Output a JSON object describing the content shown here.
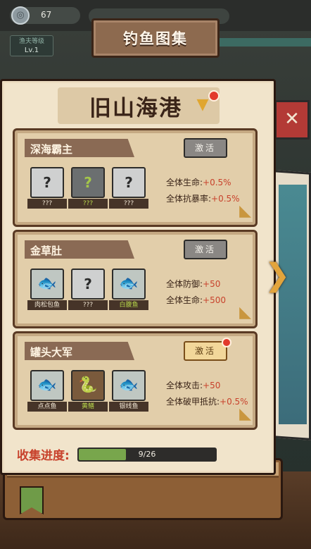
{
  "topbar": {
    "coin_value": "67",
    "level_title": "渔夫等级",
    "level_value": "Lv.1"
  },
  "header": {
    "title": "钓鱼图集"
  },
  "section": {
    "title": "旧山海港"
  },
  "categories": [
    {
      "name": "深海霸主",
      "activate_label": "激活",
      "active": false,
      "fish": [
        {
          "label": "???",
          "glyph": "?",
          "state": "unknown"
        },
        {
          "label": "???",
          "glyph": "?",
          "state": "dark"
        },
        {
          "label": "???",
          "glyph": "?",
          "state": "unknown"
        }
      ],
      "bonuses": [
        {
          "name": "全体生命:",
          "value": "+0.5%"
        },
        {
          "name": "全体抗暴率:",
          "value": "+0.5%"
        }
      ]
    },
    {
      "name": "金草肚",
      "activate_label": "激活",
      "active": false,
      "fish": [
        {
          "label": "肉松包鱼",
          "glyph": "🐟",
          "state": "found"
        },
        {
          "label": "???",
          "glyph": "?",
          "state": "unknown"
        },
        {
          "label": "白腹鱼",
          "glyph": "🐟",
          "state": "found-green"
        }
      ],
      "bonuses": [
        {
          "name": "全体防御:",
          "value": "+50"
        },
        {
          "name": "全体生命:",
          "value": "+500"
        }
      ]
    },
    {
      "name": "罐头大军",
      "activate_label": "激活",
      "active": true,
      "fish": [
        {
          "label": "点点鱼",
          "glyph": "🐟",
          "state": "found"
        },
        {
          "label": "黄鳝",
          "glyph": "🐍",
          "state": "found-green"
        },
        {
          "label": "银线鱼",
          "glyph": "🐟",
          "state": "found"
        }
      ],
      "bonuses": [
        {
          "name": "全体攻击:",
          "value": "+50"
        },
        {
          "name": "全体破甲抵抗:",
          "value": "+0.5%"
        }
      ]
    }
  ],
  "progress": {
    "label": "收集进度:",
    "text": "9/26",
    "fraction": 0.346
  },
  "colors": {
    "accent_red": "#c8422c",
    "progress_green": "#78a64c"
  }
}
